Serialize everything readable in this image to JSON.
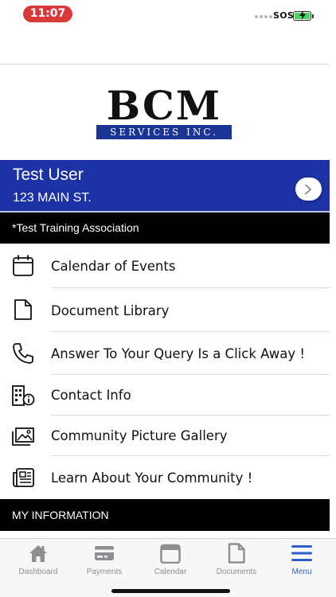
{
  "status_bar": {
    "time": "11:07",
    "carrier": "SOS",
    "battery_color": "#4cd35f"
  },
  "logo": {
    "mark": "BCM",
    "subtitle": "SERVICES INC.",
    "brand_color": "#1b3594"
  },
  "user": {
    "name": "Test User",
    "address": "123 MAIN ST.",
    "banner_color": "#1c32a5",
    "arrow_icon": "chevron-right-icon"
  },
  "association": {
    "label": "*Test Training Association"
  },
  "menu": {
    "items": [
      {
        "label": "Calendar of Events",
        "icon": "calendar-icon"
      },
      {
        "label": "Document Library",
        "icon": "document-icon"
      },
      {
        "label": "Answer To Your Query Is a Click Away !",
        "icon": "phone-icon"
      },
      {
        "label": "Contact Info",
        "icon": "building-info-icon"
      },
      {
        "label": "Community Picture Gallery",
        "icon": "gallery-icon"
      },
      {
        "label": "Learn About Your Community !",
        "icon": "newspaper-icon"
      }
    ]
  },
  "my_information": {
    "label": "MY INFORMATION"
  },
  "tab_bar": {
    "active_color": "#2d5fc8",
    "inactive_color": "#8e8e93",
    "tabs": [
      {
        "label": "Dashboard",
        "icon": "home-icon",
        "active": false
      },
      {
        "label": "Payments",
        "icon": "credit-card-icon",
        "active": false
      },
      {
        "label": "Calendar",
        "icon": "calendar-icon",
        "active": false
      },
      {
        "label": "Documents",
        "icon": "document-icon",
        "active": false
      },
      {
        "label": "Menu",
        "icon": "menu-icon",
        "active": true
      }
    ]
  }
}
